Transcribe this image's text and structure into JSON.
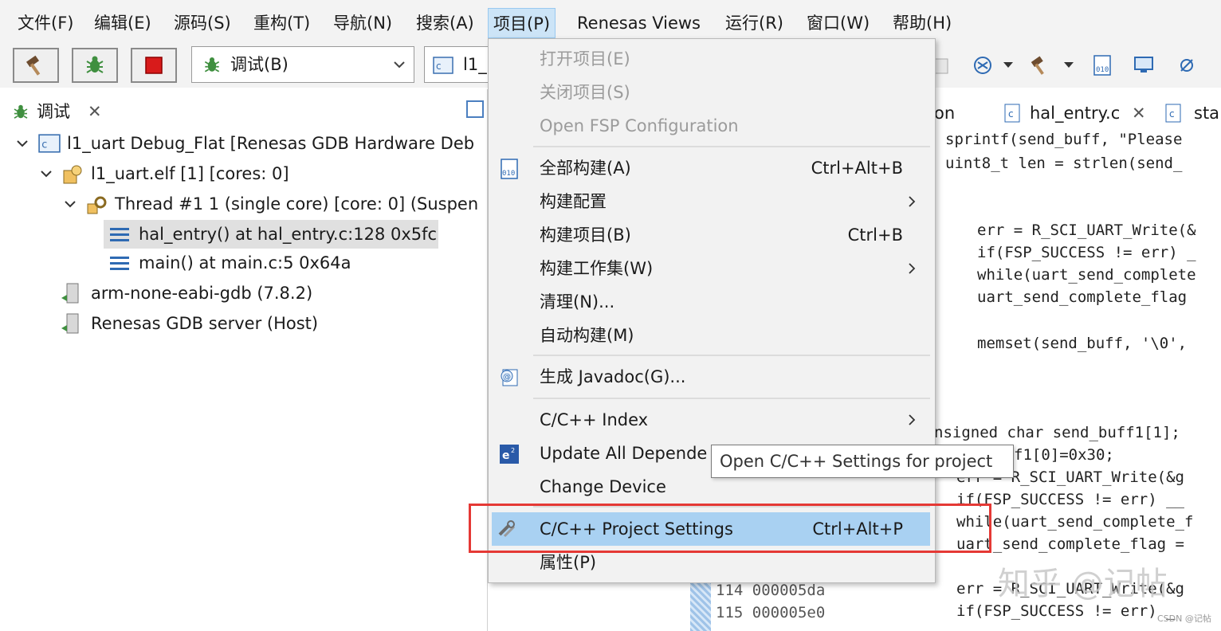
{
  "menubar": {
    "items": [
      "文件(F)",
      "编辑(E)",
      "源码(S)",
      "重构(T)",
      "导航(N)",
      "搜索(A)",
      "项目(P)",
      "Renesas Views",
      "运行(R)",
      "窗口(W)",
      "帮助(H)"
    ],
    "active": "项目(P)"
  },
  "toolbar": {
    "launch_mode": "调试(B)",
    "launch_config": "l1_"
  },
  "debug_view": {
    "tab_label": "调试",
    "rows": [
      "l1_uart Debug_Flat [Renesas GDB Hardware Deb",
      "l1_uart.elf [1] [cores: 0]",
      "Thread #1 1 (single core) [core: 0] (Suspen",
      "hal_entry() at hal_entry.c:128 0x5fc",
      "main() at main.c:5 0x64a",
      "arm-none-eabi-gdb (7.8.2)",
      "Renesas GDB server (Host)"
    ]
  },
  "editor": {
    "tabs": [
      "on",
      "hal_entry.c",
      "sta"
    ],
    "lines": [
      "sprintf(send_buff, \"Please",
      "uint8_t len = strlen(send_",
      "err = R_SCI_UART_Write(&",
      "if(FSP_SUCCESS != err) _",
      "while(uart_send_complete",
      "uart_send_complete_flag",
      "memset(send_buff, '\\0',",
      "nsigned char send_buff1[1];",
      "f1[0]=0x30;",
      "err = R_SCI_UART_Write(&g",
      "if(FSP_SUCCESS != err) __",
      "while(uart_send_complete_f",
      "uart_send_complete_flag =",
      "err = R_SCI_UART_Write(&g",
      "if(FSP_SUCCESS != err) _"
    ]
  },
  "disassembly": {
    "lines": [
      "114 000005da",
      "115 000005e0"
    ]
  },
  "project_menu": {
    "items": {
      "open_project": "打开项目(E)",
      "close_project": "关闭项目(S)",
      "open_fsp": "Open FSP Configuration",
      "build_all": "全部构建(A)",
      "build_all_shortcut": "Ctrl+Alt+B",
      "build_config": "构建配置",
      "build_project": "构建项目(B)",
      "build_project_shortcut": "Ctrl+B",
      "build_working_set": "构建工作集(W)",
      "clean": "清理(N)...",
      "auto_build": "自动构建(M)",
      "javadoc": "生成 Javadoc(G)...",
      "cpp_index": "C/C++ Index",
      "update_deps": "Update All Depende",
      "change_device": "Change Device",
      "project_settings": "C/C++ Project Settings",
      "project_settings_shortcut": "Ctrl+Alt+P",
      "properties": "属性(P)"
    }
  },
  "tooltip": "Open C/C++ Settings for project",
  "watermark": "知乎 @记帖",
  "small_watermark": "CSDN @记帖",
  "colors": {
    "highlight": "#a9d1f2",
    "annotation_box": "#e53935",
    "menu_active": "#cce4f7"
  }
}
